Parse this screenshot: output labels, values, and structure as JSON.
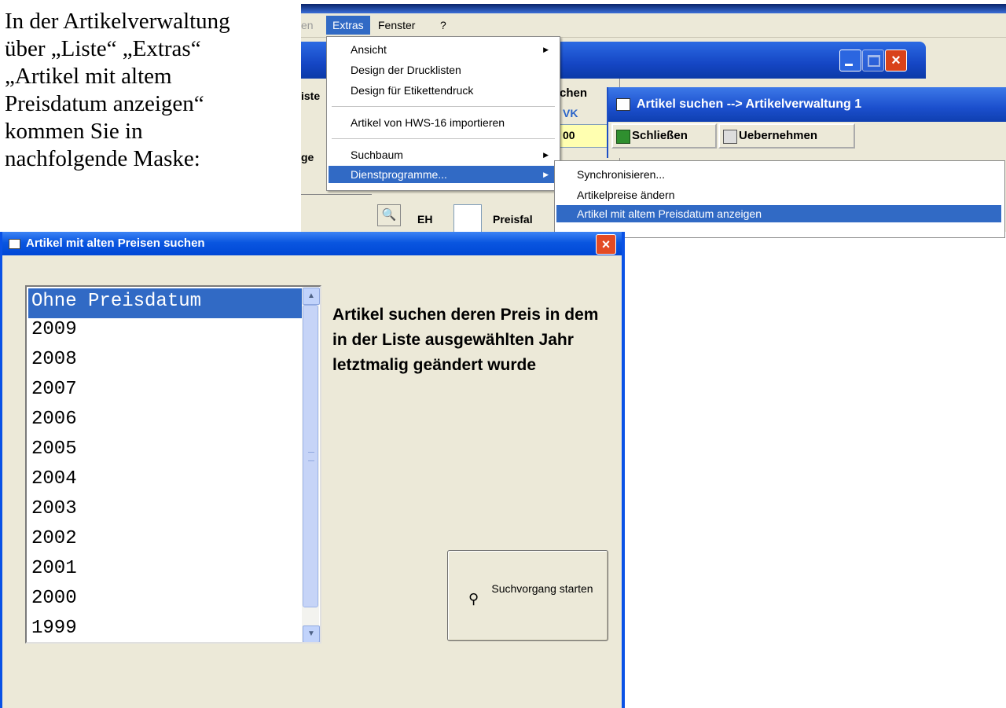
{
  "intro_text": [
    "In der Artikelverwaltung",
    "über „Liste“ „Extras“",
    "„Artikel mit altem",
    "Preisdatum anzeigen“",
    "kommen Sie in",
    "nachfolgende Maske:"
  ],
  "menubar": {
    "cut_item": "en",
    "extras": "Extras",
    "fenster": "Fenster",
    "help": "?"
  },
  "extras_menu": {
    "items": [
      "Ansicht",
      "Design der Drucklisten",
      "Design für Etikettendruck",
      "Artikel von HWS-16 importieren",
      "Suchbaum",
      "Dienstprogramme..."
    ]
  },
  "background_fragments": {
    "liste": "iste",
    "suchen": "chen",
    "vk": "VK",
    "value00": "00",
    "ge": "ge",
    "eh": "EH",
    "preisfal": "Preisfal"
  },
  "search_window": {
    "title": "Artikel suchen --> Artikelverwaltung 1",
    "close_btn": "Schließen",
    "apply_btn": "Uebernehmen"
  },
  "submenu": {
    "items": [
      "Synchronisieren...",
      "Artikelpreise ändern",
      "Artikel mit altem Preisdatum anzeigen"
    ]
  },
  "dialog": {
    "title": "Artikel mit alten Preisen suchen",
    "list": [
      "Ohne Preisdatum",
      "2009",
      "2008",
      "2007",
      "2006",
      "2005",
      "2004",
      "2003",
      "2002",
      "2001",
      "2000",
      "1999"
    ],
    "description": "Artikel suchen deren Preis in dem in der Liste ausgewählten Jahr letztmalig geändert wurde",
    "start_button": "Suchvorgang starten"
  },
  "colors": {
    "xp_blue": "#0a52e6",
    "selection": "#316ac5",
    "dialog_bg": "#ece9d8"
  }
}
